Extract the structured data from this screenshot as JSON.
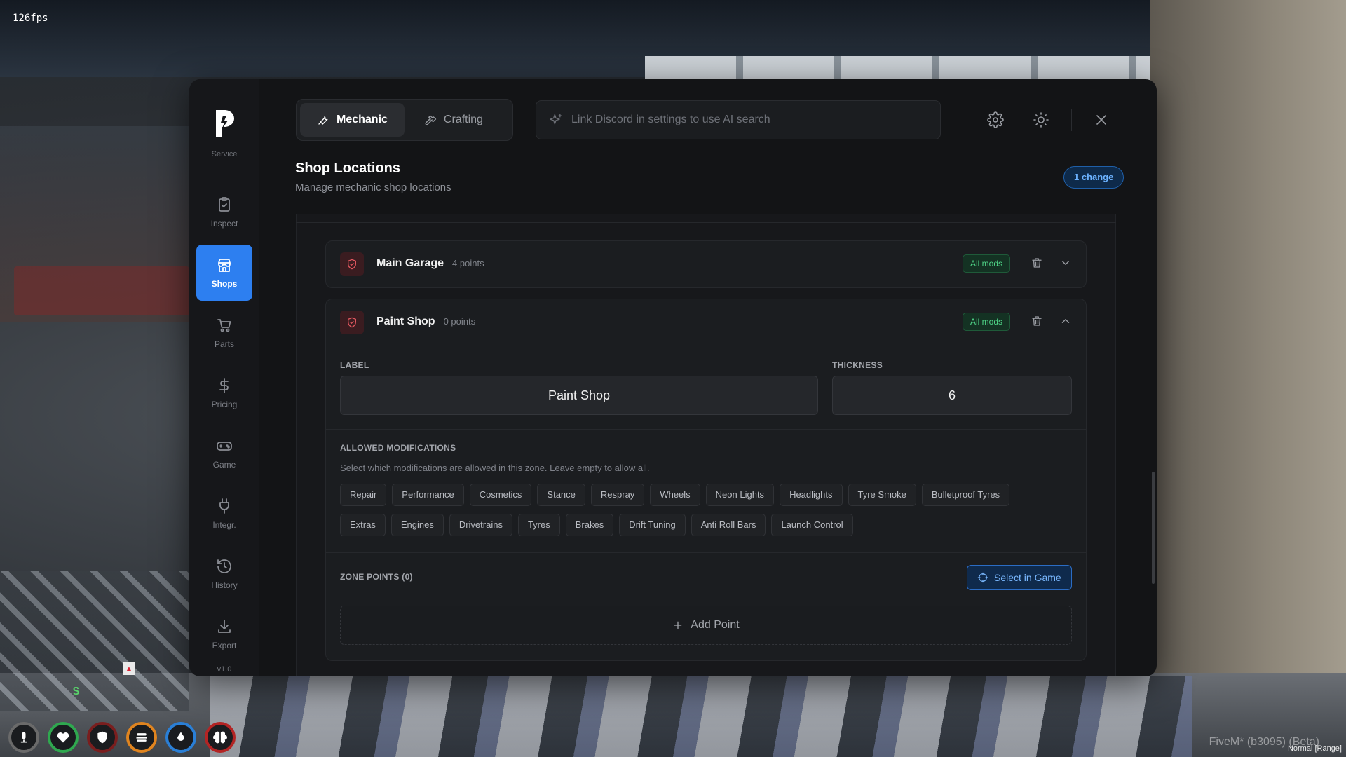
{
  "overlay": {
    "fps": "126fps",
    "map_dollar": "$",
    "watermark": "FiveM* (b3095) (Beta)",
    "watermark_mode": "Normal [Range]"
  },
  "hud": [
    "microphone-icon",
    "heart-icon",
    "shield-icon",
    "burger-icon",
    "droplet-icon",
    "brain-icon"
  ],
  "sidebar": {
    "cut_label": "Service",
    "items": [
      {
        "label": "Inspect",
        "icon": "clipboard-icon"
      },
      {
        "label": "Shops",
        "icon": "store-icon",
        "active": true
      },
      {
        "label": "Parts",
        "icon": "cart-icon"
      },
      {
        "label": "Pricing",
        "icon": "dollar-icon"
      },
      {
        "label": "Game",
        "icon": "gamepad-icon"
      },
      {
        "label": "Integr.",
        "icon": "plug-icon"
      },
      {
        "label": "History",
        "icon": "history-icon"
      },
      {
        "label": "Export",
        "icon": "download-icon"
      }
    ],
    "version": "v1.0"
  },
  "header": {
    "tabs": [
      {
        "label": "Mechanic",
        "icon": "wrench-icon",
        "active": true
      },
      {
        "label": "Crafting",
        "icon": "hammer-icon",
        "active": false
      }
    ],
    "search_placeholder": "Link Discord in settings to use AI search",
    "page_title": "Shop Locations",
    "page_subtitle": "Manage mechanic shop locations",
    "change_badge": "1 change"
  },
  "colors": {
    "accent": "#2d7ff0",
    "danger": "#e0575f",
    "success": "#4fd487",
    "panel_bg": "#131416"
  },
  "shops": [
    {
      "name": "Main Garage",
      "points": "4 points",
      "mods": "All mods",
      "expanded": false
    },
    {
      "name": "Paint Shop",
      "points": "0 points",
      "mods": "All mods",
      "expanded": true,
      "label_title": "LABEL",
      "label_value": "Paint Shop",
      "thickness_title": "THICKNESS",
      "thickness_value": "6",
      "allowed_title": "ALLOWED MODIFICATIONS",
      "allowed_desc": "Select which modifications are allowed in this zone. Leave empty to allow all.",
      "mods_row1": [
        "Repair",
        "Performance",
        "Cosmetics",
        "Stance",
        "Respray",
        "Wheels",
        "Neon Lights",
        "Headlights",
        "Tyre Smoke",
        "Bulletproof Tyres"
      ],
      "mods_row2": [
        "Extras",
        "Engines",
        "Drivetrains",
        "Tyres",
        "Brakes",
        "Drift Tuning",
        "Anti Roll Bars",
        "Launch Control"
      ],
      "zone_title": "ZONE POINTS (0)",
      "select_label": "Select in Game",
      "add_point_label": "Add Point"
    }
  ]
}
